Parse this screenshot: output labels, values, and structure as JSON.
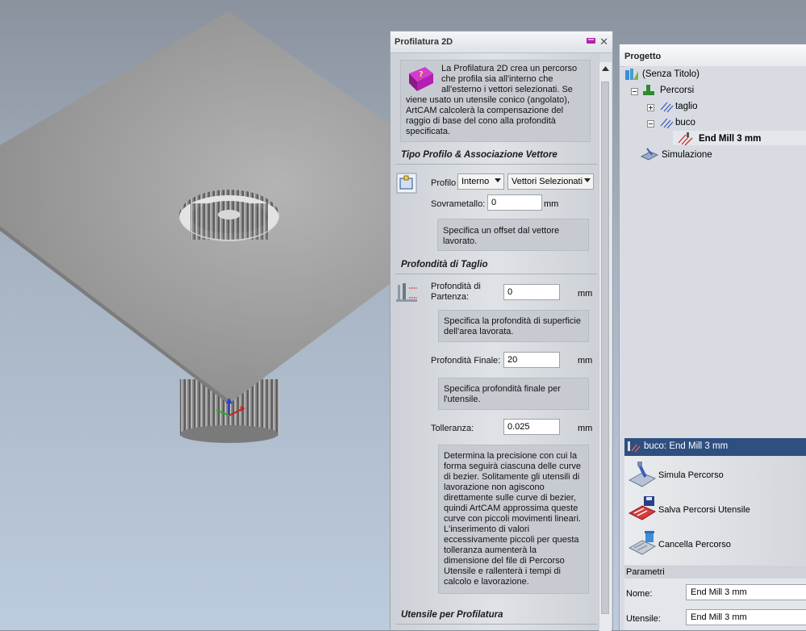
{
  "panel": {
    "title": "Profilatura 2D",
    "intro": "La Profilatura 2D crea un percorso che profila sia all'interno che all'esterno i vettori selezionati. Se viene usato un utensile conico (angolato), ArtCAM calcolerà la compensazione del raggio di base del cono alla profondità specificata.",
    "section_profile": "Tipo Profilo & Associazione Vettore",
    "profile_label": "Profilo",
    "profile_value": "Interno",
    "vectors_value": "Vettori Selezionati",
    "allowance_label": "Sovrametallo:",
    "allowance_value": "0",
    "allowance_unit": "mm",
    "allowance_help": "Specifica un offset dal vettore lavorato.",
    "section_depth": "Profondità di Taglio",
    "start_label": "Profondità di Partenza:",
    "start_value": "0",
    "start_unit": "mm",
    "start_help": "Specifica la profondità di superficie dell'area lavorata.",
    "final_label": "Profondità Finale:",
    "final_value": "20",
    "final_unit": "mm",
    "final_help": "Specifica profondità finale per l'utensile.",
    "tol_label": "Tolleranza:",
    "tol_value": "0.025",
    "tol_unit": "mm",
    "tol_help": "Determina la precisione con cui la forma seguirà ciascuna delle curve di bezier. Solitamente gli utensili di lavorazione non agiscono direttamente sulle curve di bezier, quindi ArtCAM approssima queste curve con piccoli movimenti lineari. L'inserimento di valori eccessivamente piccoli per questa tolleranza aumenterà la dimensione del file di Percorso Utensile e rallenterà i tempi di calcolo e lavorazione.",
    "section_tool": "Utensile per Profilatura"
  },
  "project": {
    "title": "Progetto",
    "root": "(Senza Titolo)",
    "paths": "Percorsi",
    "item1": "taglio",
    "item2": "buco",
    "tool": "End Mill 3 mm",
    "simulation": "Simulazione",
    "toolpath_header": "buco: End Mill 3 mm",
    "actions": [
      "Simula Percorso",
      "Salva Percorsi Utensile",
      "Cancella Percorso"
    ],
    "params_header": "Parametri",
    "name_label": "Nome:",
    "name_value": "End Mill 3 mm",
    "tool_label": "Utensile:",
    "tool_value": "End Mill 3 mm"
  },
  "colors": {
    "header_blue": "#2e4f80",
    "background_gradient_top": "#8a929e",
    "background_gradient_bottom": "#bccbde"
  }
}
